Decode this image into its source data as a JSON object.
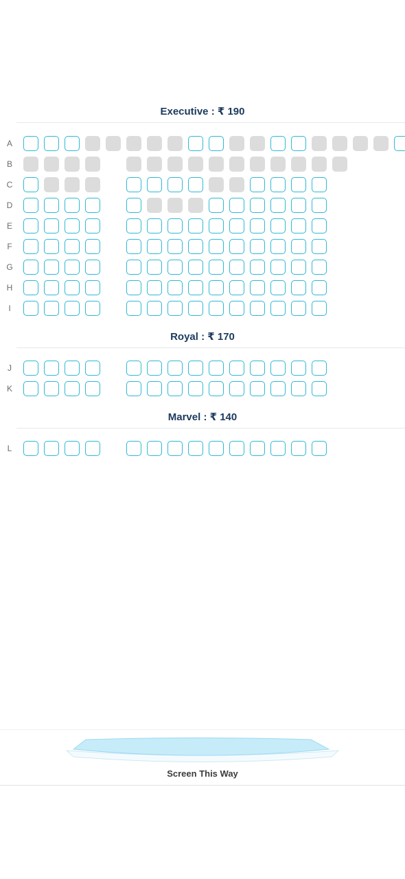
{
  "sections": [
    {
      "title": "Executive : ₹ 190",
      "rows": [
        {
          "label": "A",
          "seats": "aaabbbbbaabbaabbbba"
        },
        {
          "label": "B",
          "seats": "bbbb.bbbbbbbbbbb...b"
        },
        {
          "label": "C",
          "seats": "abbb.aaaabbaaaa....a"
        },
        {
          "label": "D",
          "seats": "aaaa.abbbaaaaaa....a"
        },
        {
          "label": "E",
          "seats": "aaaa.aaaaaaaaaa"
        },
        {
          "label": "F",
          "seats": "aaaa.aaaaaaaaaa"
        },
        {
          "label": "G",
          "seats": "aaaa.aaaaaaaaaa"
        },
        {
          "label": "H",
          "seats": "aaaa.aaaaaaaaaa"
        },
        {
          "label": "I",
          "seats": "aaaa.aaaaaaaaaa"
        }
      ]
    },
    {
      "title": "Royal : ₹ 170",
      "rows": [
        {
          "label": "J",
          "seats": "aaaa.aaaaaaaaaa....a"
        },
        {
          "label": "K",
          "seats": "aaaa.aaaaaaaaaa....a"
        }
      ]
    },
    {
      "title": "Marvel : ₹ 140",
      "rows": [
        {
          "label": "L",
          "seats": "aaaa.aaaaaaaaaa....a"
        }
      ]
    }
  ],
  "screen": {
    "label": "Screen This Way"
  },
  "colors": {
    "available": "#2fb8d4",
    "booked": "#dcdcdc",
    "title": "#1c3a5e",
    "screen": "#c6ecfa"
  }
}
